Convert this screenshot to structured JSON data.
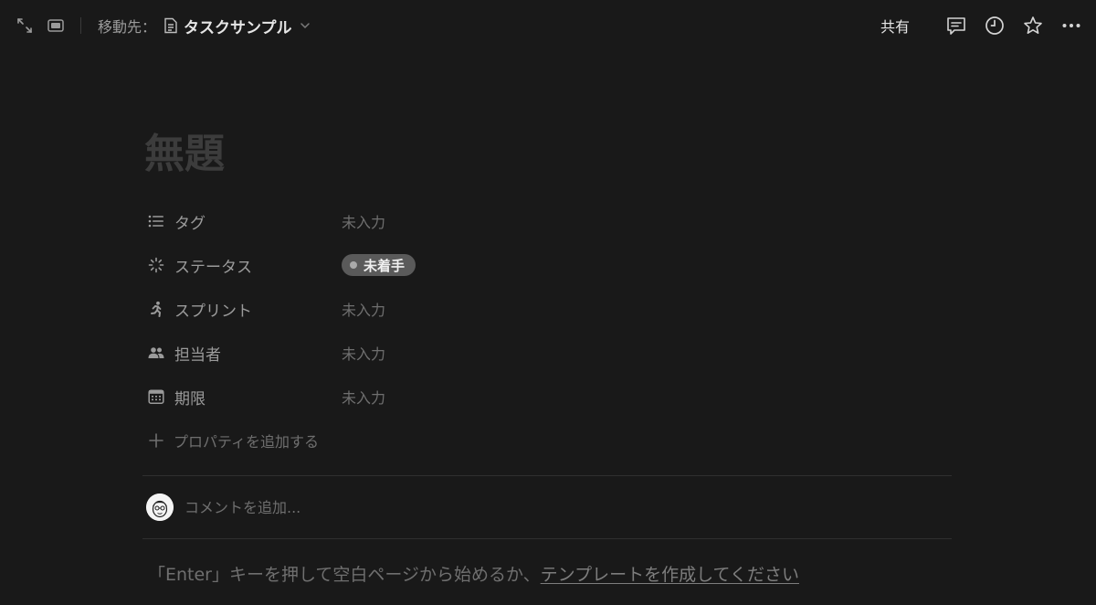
{
  "topbar": {
    "move_to_label": "移動先：",
    "page_name": "タスクサンプル",
    "share_label": "共有"
  },
  "icons": {
    "expand": "expand-icon",
    "peek_mode": "peek-mode-icon",
    "page": "page-icon",
    "chevron": "chevron-down-icon",
    "comments": "comment-icon",
    "history": "clock-icon",
    "favorite": "star-icon",
    "more": "more-icon"
  },
  "page": {
    "title": "無題"
  },
  "properties": [
    {
      "name": "タグ",
      "icon": "list-icon",
      "value": "未入力"
    },
    {
      "name": "ステータス",
      "icon": "status-spinner-icon",
      "value": "未着手"
    },
    {
      "name": "スプリント",
      "icon": "runner-icon",
      "value": "未入力"
    },
    {
      "name": "担当者",
      "icon": "people-icon",
      "value": "未入力"
    },
    {
      "name": "期限",
      "icon": "calendar-icon",
      "value": "未入力"
    }
  ],
  "add_property_label": "プロパティを追加する",
  "comment": {
    "placeholder": "コメントを追加..."
  },
  "hint": {
    "prefix": "「Enter」キーを押して空白ページから始めるか、",
    "link": "テンプレートを作成してください"
  },
  "colors": {
    "background": "#191919",
    "status_pill": "#5a5a5a"
  }
}
